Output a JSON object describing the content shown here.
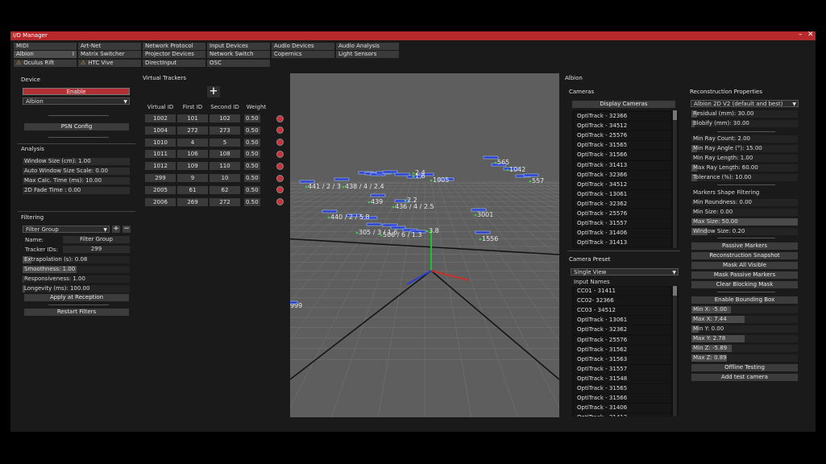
{
  "window": {
    "title": "I/O Manager",
    "minimize": "–",
    "close": "✕"
  },
  "tabs": [
    {
      "label": "MIDI",
      "warn": false,
      "selected": false
    },
    {
      "label": "Art-Net",
      "warn": false,
      "selected": false
    },
    {
      "label": "Network Protocol",
      "warn": false,
      "selected": false
    },
    {
      "label": "Input Devices",
      "warn": false,
      "selected": false
    },
    {
      "label": "Audio Devices",
      "warn": false,
      "selected": false
    },
    {
      "label": "Audio Analysis",
      "warn": false,
      "selected": false
    },
    {
      "label": "Albion",
      "warn": false,
      "selected": true
    },
    {
      "label": "Matrix Switcher",
      "warn": false,
      "selected": false
    },
    {
      "label": "Projector Devices",
      "warn": false,
      "selected": false
    },
    {
      "label": "Network Switch",
      "warn": false,
      "selected": false
    },
    {
      "label": "Copernics",
      "warn": false,
      "selected": false
    },
    {
      "label": "Light Sensors",
      "warn": false,
      "selected": false
    },
    {
      "label": "Oculus Rift",
      "warn": true,
      "selected": false
    },
    {
      "label": "HTC Vive",
      "warn": true,
      "selected": false
    },
    {
      "label": "DirectInput",
      "warn": false,
      "selected": false
    },
    {
      "label": "OSC",
      "warn": false,
      "selected": false
    }
  ],
  "device": {
    "heading": "Device",
    "enable_label": "Enable",
    "selected_device": "Albion",
    "psn_config_label": "PSN Config"
  },
  "analysis": {
    "heading": "Analysis",
    "fields": [
      "Window Size (cm): 1.00",
      "Auto Window Size Scale: 0.00",
      "Max Calc. Time (ms): 10.00",
      "2D Fade Time : 0.00"
    ]
  },
  "filtering": {
    "heading": "Filtering",
    "filter_select": "Filter Group",
    "add": "+",
    "remove": "−",
    "name_label": "Name:",
    "name_value": "Filter Group",
    "tracker_ids_label": "Tracker IDs:",
    "tracker_ids_value": "299",
    "params": [
      {
        "text": "Extrapolation (s): 0.08",
        "level": 0.08
      },
      {
        "text": "Smoothness: 1.00",
        "level": 0.5
      },
      {
        "text": "Responsiveness: 1.00",
        "level": 0.01
      },
      {
        "text": "Longevity (ms): 100.00",
        "level": 0.02
      }
    ],
    "apply_label": "Apply at Reception",
    "restart_label": "Restart Filters"
  },
  "virtual_trackers": {
    "heading": "Virtual Trackers",
    "add": "+",
    "columns": [
      "Virtual ID",
      "First ID",
      "Second ID",
      "Weight"
    ],
    "rows": [
      [
        "1002",
        "101",
        "102",
        "0.50"
      ],
      [
        "1004",
        "272",
        "273",
        "0.50"
      ],
      [
        "1010",
        "4",
        "5",
        "0.50"
      ],
      [
        "1011",
        "106",
        "108",
        "0.50"
      ],
      [
        "1012",
        "109",
        "110",
        "0.50"
      ],
      [
        "299",
        "9",
        "10",
        "0.50"
      ],
      [
        "2005",
        "61",
        "62",
        "0.50"
      ],
      [
        "2006",
        "269",
        "272",
        "0.50"
      ]
    ]
  },
  "viewport": {
    "labels": [
      "441 / 2 / 3",
      "438 / 4 / 2.4",
      "440 / 2 / 5.8",
      "436 / 4 / 2.5",
      "439",
      "2.2",
      "3001",
      "1556",
      "1005",
      "1.6",
      "2.4",
      "557",
      "1042",
      "565",
      "999",
      "305 / 3 / 1.6",
      "506 / 6 / 1.3",
      "3.8"
    ]
  },
  "albion": {
    "heading": "Albion",
    "cameras_heading": "Cameras",
    "display_cameras_label": "Display Cameras",
    "cameras": [
      "OptiTrack - 32366",
      "OptiTrack - 34512",
      "OptiTrack - 25576",
      "OptiTrack - 31565",
      "OptiTrack - 31566",
      "OptiTrack - 31413",
      "OptiTrack - 32366",
      "OptiTrack - 34512",
      "OptiTrack - 13061",
      "OptiTrack - 32362",
      "OptiTrack - 25576",
      "OptiTrack - 31557",
      "OptiTrack - 31406",
      "OptiTrack - 31413"
    ],
    "camera_preset_heading": "Camera Preset",
    "preset_selected": "Single View",
    "input_names_heading": "Input Names",
    "input_names": [
      "CC01 - 31411",
      "CC02- 32366",
      "CC03 - 34512",
      "OptiTrack - 13061",
      "OptiTrack - 32362",
      "OptiTrack - 25576",
      "OptiTrack - 31562",
      "OptiTrack - 31563",
      "OptiTrack - 31557",
      "OptiTrack - 31548",
      "OptiTrack - 31565",
      "OptiTrack - 31566",
      "OptiTrack - 31406",
      "OptiTrack - 31413"
    ]
  },
  "reconstruction": {
    "heading": "Reconstruction Properties",
    "algorithm": "Albion 2D V2 (default and best)",
    "fields_top": [
      {
        "text": "Residual (mm): 30.00",
        "level": 0.05
      },
      {
        "text": "Blobify (mm): 30.00",
        "level": 0.03
      }
    ],
    "fields_ray": [
      {
        "text": "Min Ray Count: 2.00",
        "level": 0.0
      },
      {
        "text": "Min Ray Angle (°): 15.00",
        "level": 0.05
      },
      {
        "text": "Min Ray Length: 1.00",
        "level": 0.0
      },
      {
        "text": "Max Ray Length: 60.00",
        "level": 0.05
      },
      {
        "text": "Tolerance (%): 10.00",
        "level": 0.05
      }
    ],
    "markers_shape_heading": "Markers Shape Filtering",
    "fields_shape": [
      {
        "text": "Min Roundness: 0.00",
        "level": 0.0
      },
      {
        "text": "Min Size: 0.00",
        "level": 0.0
      },
      {
        "text": "Max Size: 50.00",
        "level": 1.0
      },
      {
        "text": "Window Size: 0.20",
        "level": 0.15
      }
    ],
    "passive_markers_label": "Passive Markers",
    "buttons": [
      "Reconstruction Snapshot",
      "Mask All Visible",
      "Mask Passive Markers",
      "Clear Blocking Mask"
    ],
    "bounding_box_label": "Enable Bounding Box",
    "bounds": [
      {
        "text": "Min X: -5.00",
        "level": 0.37
      },
      {
        "text": "Max X: 7.44",
        "level": 0.5
      },
      {
        "text": "Min Y: 0.00",
        "level": 0.07
      },
      {
        "text": "Max Y: 2.78",
        "level": 0.5
      },
      {
        "text": "Min Z: -5.89",
        "level": 0.38
      },
      {
        "text": "Max Z: 0.89",
        "level": 0.33
      }
    ],
    "offline_testing_label": "Offline Testing",
    "add_test_camera_label": "Add test camera"
  }
}
